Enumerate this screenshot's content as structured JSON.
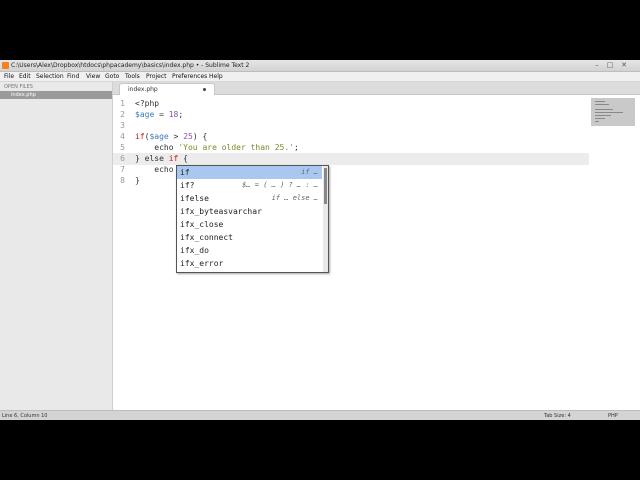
{
  "window": {
    "title": "C:\\Users\\Alex\\Dropbox\\htdocs\\phpacademy\\basics\\index.php • - Sublime Text 2",
    "controls": {
      "minimize": "–",
      "maximize": "□",
      "close": "✕"
    }
  },
  "menu": [
    "File",
    "Edit",
    "Selection",
    "Find",
    "View",
    "Goto",
    "Tools",
    "Project",
    "Preferences",
    "Help"
  ],
  "sidebar": {
    "header": "OPEN FILES",
    "files": [
      "index.php"
    ]
  },
  "tab": {
    "label": "index.php",
    "modified_icon": "dot-icon"
  },
  "editor": {
    "line_numbers": [
      "1",
      "2",
      "3",
      "4",
      "5",
      "6",
      "7",
      "8"
    ],
    "current_line": 6,
    "lines": [
      [
        {
          "t": "<?php",
          "c": "tag"
        }
      ],
      [
        {
          "t": "$age",
          "c": "var"
        },
        {
          "t": " = ",
          "c": "tag"
        },
        {
          "t": "18",
          "c": "num"
        },
        {
          "t": ";",
          "c": "tag"
        }
      ],
      [],
      [
        {
          "t": "if",
          "c": "kw"
        },
        {
          "t": "(",
          "c": "tag"
        },
        {
          "t": "$age",
          "c": "var"
        },
        {
          "t": " > ",
          "c": "tag"
        },
        {
          "t": "25",
          "c": "num"
        },
        {
          "t": ") {",
          "c": "tag"
        }
      ],
      [
        {
          "t": "    echo ",
          "c": "tag"
        },
        {
          "t": "'You are older than 25.'",
          "c": "str"
        },
        {
          "t": ";",
          "c": "tag"
        }
      ],
      [
        {
          "t": "} else ",
          "c": "tag"
        },
        {
          "t": "if",
          "c": "kw"
        },
        {
          "t": " {",
          "c": "tag"
        }
      ],
      [
        {
          "t": "    echo",
          "c": "tag"
        }
      ],
      [
        {
          "t": "}",
          "c": "tag"
        }
      ]
    ]
  },
  "autocomplete": {
    "items": [
      {
        "trigger": "if",
        "hint": "if …"
      },
      {
        "trigger": "if?",
        "hint": "$… = ( … ) ? … : …"
      },
      {
        "trigger": "ifelse",
        "hint": "if … else …"
      },
      {
        "trigger": "ifx_byteasvarchar",
        "hint": ""
      },
      {
        "trigger": "ifx_close",
        "hint": ""
      },
      {
        "trigger": "ifx_connect",
        "hint": ""
      },
      {
        "trigger": "ifx_do",
        "hint": ""
      },
      {
        "trigger": "ifx_error",
        "hint": ""
      }
    ],
    "selected_index": 0
  },
  "status": {
    "position": "Line 6, Column 10",
    "tab_size": "Tab Size: 4",
    "syntax": "PHP"
  }
}
